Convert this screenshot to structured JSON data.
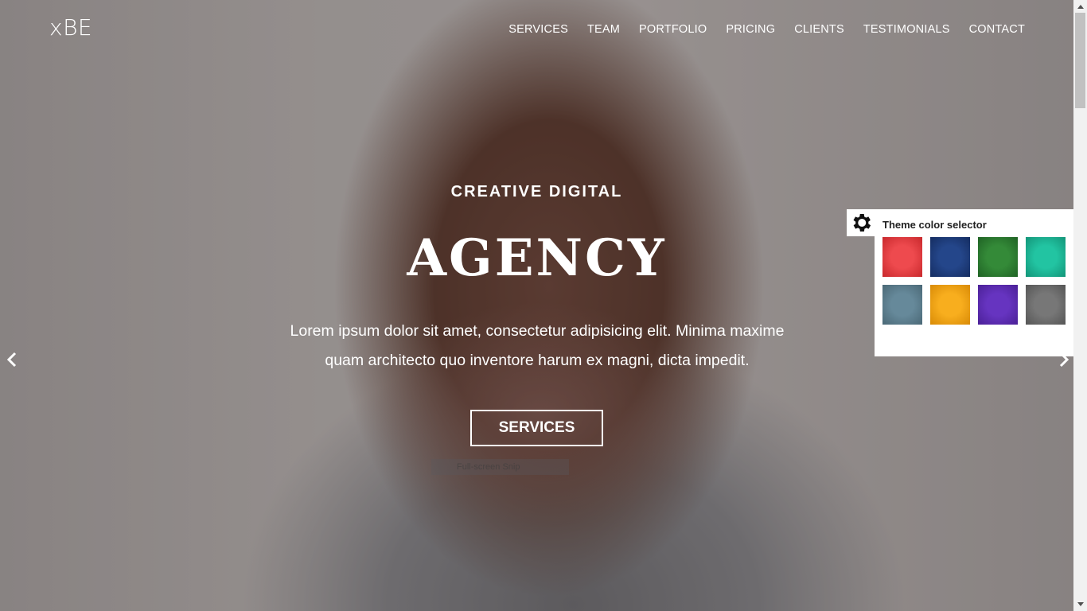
{
  "brand": "xBE",
  "nav": {
    "items": [
      "SERVICES",
      "TEAM",
      "PORTFOLIO",
      "PRICING",
      "CLIENTS",
      "TESTIMONIALS",
      "CONTACT"
    ]
  },
  "hero": {
    "kicker": "CREATIVE DIGITAL",
    "headline": "AGENCY",
    "lede": "Lorem ipsum dolor sit amet, consectetur adipisicing elit. Minima maxime quam architecto quo inventore harum ex magni, dicta impedit.",
    "cta_label": "SERVICES",
    "tooltip": "Full-screen Snip"
  },
  "carousel": {
    "prev_icon": "chevron-left-icon",
    "next_icon": "chevron-right-icon"
  },
  "theme_selector": {
    "title": "Theme color selector",
    "icon": "gear-icon",
    "swatches": [
      "#e03a3e",
      "#1b3a78",
      "#2a7a2e",
      "#1ab394",
      "#5a7a88",
      "#f0a010",
      "#5a2ab0",
      "#6a6a6a"
    ]
  }
}
